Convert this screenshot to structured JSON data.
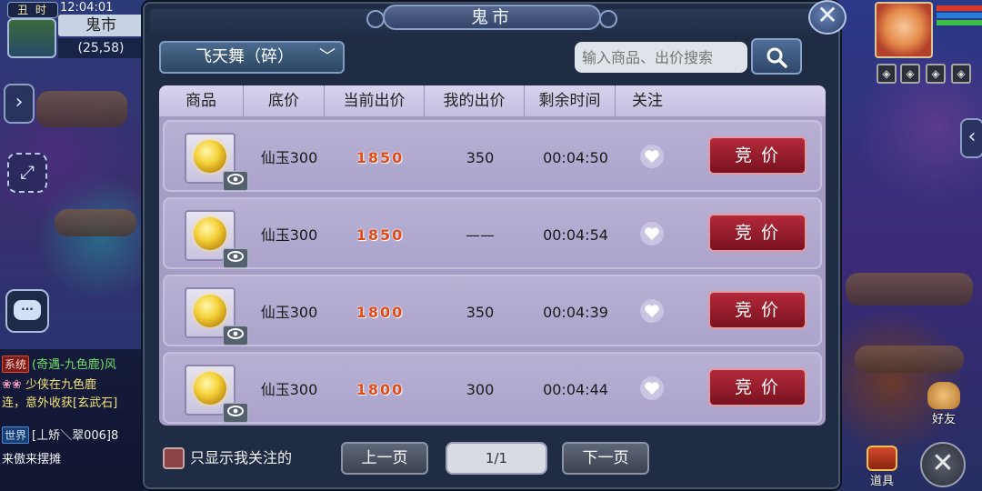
{
  "hud": {
    "shichen": "丑 时",
    "clock": "12:04:01",
    "map_name": "鬼市",
    "coords": "(25,58)",
    "friends_label": "好友",
    "items_label": "道具"
  },
  "chat": {
    "lines": [
      {
        "tag": "系统",
        "text": "(奇遇-九色鹿)风"
      },
      {
        "tag": "",
        "text": "少侠在九色鹿"
      },
      {
        "tag": "",
        "text": "连，意外收获[玄武石]"
      },
      {
        "tag": "世界",
        "text": "[丄矫＼翠006]8"
      },
      {
        "tag": "",
        "text": "来傲来摆摊"
      }
    ]
  },
  "dialog": {
    "title": "鬼市",
    "category": "飞天舞（碎）",
    "search_placeholder": "输入商品、出价搜索",
    "columns": [
      "商品",
      "底价",
      "当前出价",
      "我的出价",
      "剩余时间",
      "关注"
    ],
    "rows": [
      {
        "base": "仙玉300",
        "current": "1850",
        "mine": "350",
        "time": "00:04:50",
        "bid": "竞价"
      },
      {
        "base": "仙玉300",
        "current": "1850",
        "mine": "——",
        "time": "00:04:54",
        "bid": "竞价"
      },
      {
        "base": "仙玉300",
        "current": "1800",
        "mine": "350",
        "time": "00:04:39",
        "bid": "竞价"
      },
      {
        "base": "仙玉300",
        "current": "1800",
        "mine": "300",
        "time": "00:04:44",
        "bid": "竞价"
      }
    ],
    "only_followed_label": "只显示我关注的",
    "prev_label": "上一页",
    "page_indicator": "1/1",
    "next_label": "下一页"
  },
  "colors": {
    "price": "#e24a1a",
    "bid_button": "#9a1c2c",
    "panel": "#1f2c43",
    "table": "#a49cc2"
  }
}
